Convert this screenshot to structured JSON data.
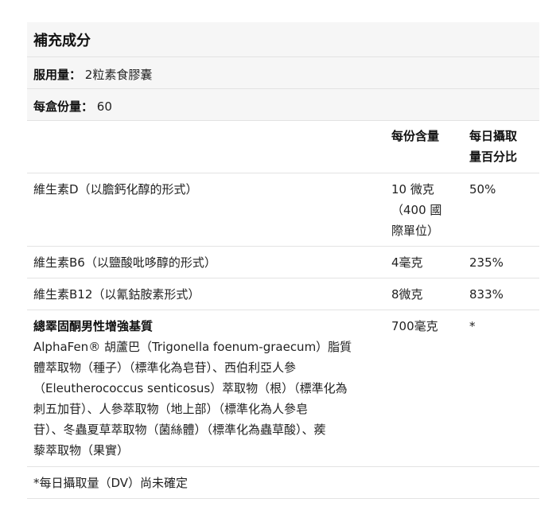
{
  "title": "補充成分",
  "serving_size": {
    "label": "服用量：",
    "value": "2粒素食膠囊"
  },
  "servings_per_container": {
    "label": "每盒份量：",
    "value": "60"
  },
  "table": {
    "col_amount": "每份含量",
    "col_dv_line1": "每日攝取",
    "col_dv_line2": "量百分比",
    "rows": [
      {
        "name": "維生素D（以膽鈣化醇的形式）",
        "amount_lines": [
          "10 微克",
          "（400 國",
          "際單位）"
        ],
        "dv": "50%"
      },
      {
        "name": "維生素B6（以鹽酸吡哆醇的形式）",
        "amount": "4毫克",
        "dv": "235%"
      },
      {
        "name": "維生素B12（以氰鈷胺素形式）",
        "amount": "8微克",
        "dv": "833%"
      }
    ],
    "blend": {
      "name": "總睪固酮男性增強基質",
      "desc_lines": [
        "AlphaFen® 胡蘆巴（Trigonella foenum-graecum）脂質",
        "體萃取物（種子）（標準化為皂苷）、西伯利亞人參",
        "（Eleutherococcus senticosus）萃取物（根）（標準化為",
        "刺五加苷）、人參萃取物（地上部）（標準化為人參皂",
        "苷）、冬蟲夏草萃取物（菌絲體）（標準化為蟲草酸）、蒺",
        "藜萃取物（果實）"
      ],
      "amount": "700毫克",
      "dv": "*"
    },
    "footnote": "*每日攝取量（DV）尚未確定"
  }
}
